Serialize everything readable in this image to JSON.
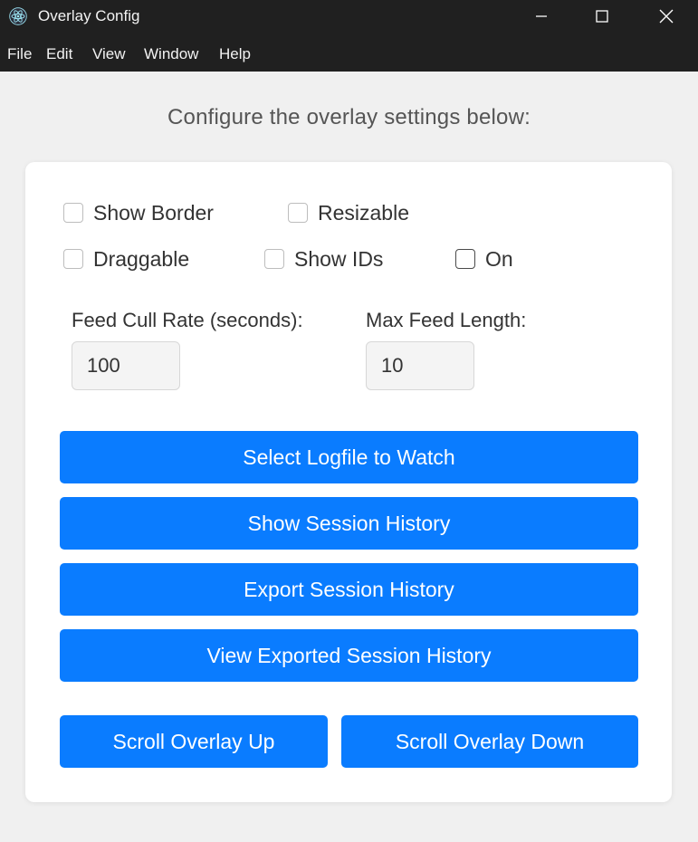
{
  "window": {
    "title": "Overlay Config",
    "icon": "electron-atom-icon"
  },
  "menu": [
    "File",
    "Edit",
    "View",
    "Window",
    "Help"
  ],
  "heading": "Configure the overlay settings below:",
  "checkboxes": {
    "show_border": {
      "label": "Show Border",
      "checked": false
    },
    "resizable": {
      "label": "Resizable",
      "checked": false
    },
    "draggable": {
      "label": "Draggable",
      "checked": false
    },
    "show_ids": {
      "label": "Show IDs",
      "checked": false
    },
    "on": {
      "label": "On",
      "checked": false
    }
  },
  "fields": {
    "cull_rate": {
      "label": "Feed Cull Rate (seconds):",
      "value": "100"
    },
    "max_length": {
      "label": "Max Feed Length:",
      "value": "10"
    }
  },
  "buttons": {
    "select_logfile": "Select Logfile to Watch",
    "show_history": "Show Session History",
    "export_history": "Export Session History",
    "view_exported": "View Exported Session History",
    "scroll_up": "Scroll Overlay Up",
    "scroll_down": "Scroll Overlay Down"
  },
  "colors": {
    "accent": "#0a7cff",
    "titlebar": "#202020"
  }
}
